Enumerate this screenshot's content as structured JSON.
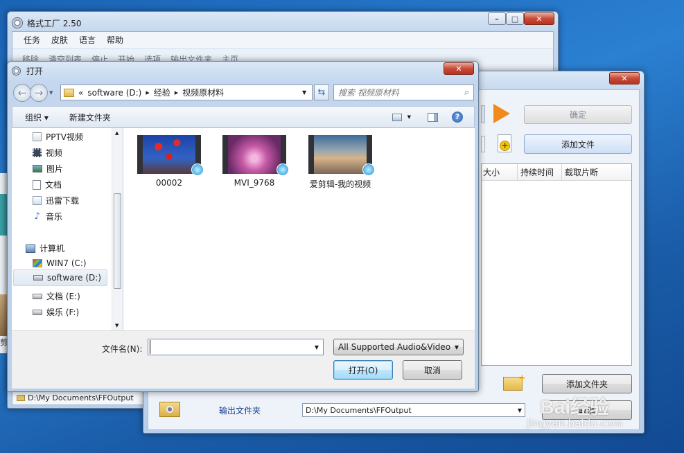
{
  "app_window": {
    "title": "格式工厂 2.50",
    "menu": [
      "任务",
      "皮肤",
      "语言",
      "帮助"
    ],
    "toolbar": [
      "移除",
      "清空列表",
      "停止",
      "开始",
      "选项",
      "输出文件夹",
      "主页"
    ],
    "status_path": "D:\\My Documents\\FFOutput"
  },
  "convert_dialog": {
    "ok_label": "确定",
    "add_file_label": "添加文件",
    "columns": [
      "大小",
      "持续时间",
      "截取片断"
    ],
    "add_folder_label": "添加文件夹",
    "output_folder_label": "输出文件夹",
    "output_path": "D:\\My Documents\\FFOutput",
    "cancel_label": "取消"
  },
  "open_dialog": {
    "title": "打开",
    "breadcrumb": [
      "«",
      "software (D:)",
      "经验",
      "视频原材料"
    ],
    "search_placeholder": "搜索 视频原材料",
    "organize_label": "组织 ▾",
    "new_folder_label": "新建文件夹",
    "nav_items": [
      {
        "label": "PPTV视频",
        "icon": "pptv-folder-icon"
      },
      {
        "label": "视频",
        "icon": "video-library-icon"
      },
      {
        "label": "图片",
        "icon": "picture-library-icon"
      },
      {
        "label": "文档",
        "icon": "document-library-icon"
      },
      {
        "label": "迅雷下载",
        "icon": "download-folder-icon"
      },
      {
        "label": "音乐",
        "icon": "music-library-icon"
      }
    ],
    "computer_label": "计算机",
    "drives": [
      {
        "label": "WIN7 (C:)",
        "icon": "windows-drive-icon",
        "selected": false
      },
      {
        "label": "software (D:)",
        "icon": "hard-drive-icon",
        "selected": true
      },
      {
        "label": "文档 (E:)",
        "icon": "hard-drive-icon",
        "selected": false
      },
      {
        "label": "娱乐 (F:)",
        "icon": "hard-drive-icon",
        "selected": false
      }
    ],
    "files": [
      {
        "name": "00002",
        "thumb": "thumb-red-lanterns"
      },
      {
        "name": "MVI_9768",
        "thumb": "thumb-pink-stage"
      },
      {
        "name": "爱剪辑-我的视频",
        "thumb": "thumb-sky-clouds"
      }
    ],
    "filename_label": "文件名(N):",
    "filename_value": "",
    "filetype_value": "All Supported Audio&Video",
    "open_label": "打开(O)",
    "cancel_label": "取消"
  },
  "watermark": {
    "brand": "Bai经验",
    "url": "jingyan.baidu.com"
  },
  "background_fragment": {
    "left_glyph": "剪"
  }
}
